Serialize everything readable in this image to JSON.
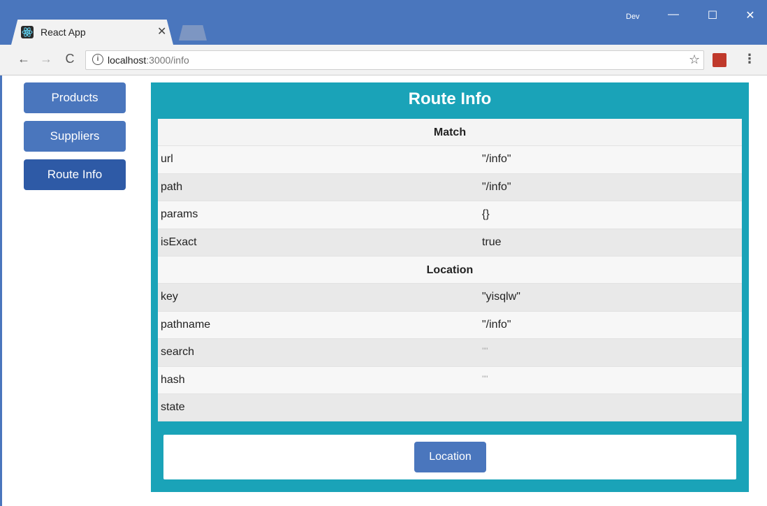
{
  "browser": {
    "tab_title": "React App",
    "profile": "Dev",
    "url_host": "localhost",
    "url_path": ":3000/info"
  },
  "nav": {
    "items": [
      {
        "label": "Products"
      },
      {
        "label": "Suppliers"
      },
      {
        "label": "Route Info"
      }
    ],
    "active": "Route Info"
  },
  "panel": {
    "title": "Route Info",
    "match_header": "Match",
    "match_rows": [
      {
        "key": "url",
        "value": "\"/info\""
      },
      {
        "key": "path",
        "value": "\"/info\""
      },
      {
        "key": "params",
        "value": "{}"
      },
      {
        "key": "isExact",
        "value": "true"
      }
    ],
    "location_header": "Location",
    "location_rows": [
      {
        "key": "key",
        "value": "\"yisqlw\""
      },
      {
        "key": "pathname",
        "value": "\"/info\""
      },
      {
        "key": "search",
        "value": "\"\""
      },
      {
        "key": "hash",
        "value": "\"\""
      },
      {
        "key": "state",
        "value": ""
      }
    ],
    "button_label": "Location"
  },
  "colors": {
    "chrome": "#4a76bd",
    "panel": "#1aa3b8",
    "button": "#4a76bd",
    "button_active": "#2e5aa6"
  }
}
